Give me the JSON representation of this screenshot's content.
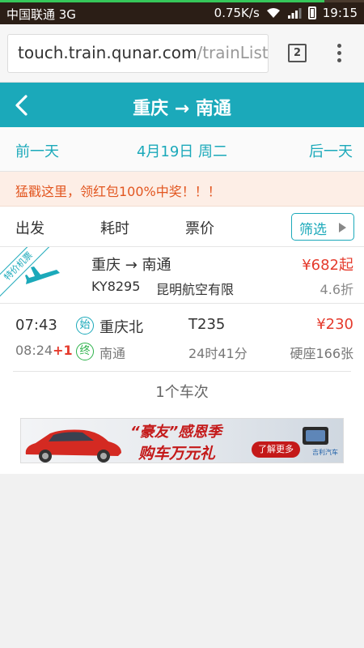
{
  "status_bar": {
    "carrier": "中国联通 3G",
    "speed": "0.75K/s",
    "time": "19:15",
    "page_load_progress": 0.89
  },
  "browser": {
    "url_host": "touch.train.qunar.com",
    "url_path": "/trainList",
    "tab_count": "2"
  },
  "header": {
    "title": "重庆 → 南通"
  },
  "date_nav": {
    "prev": "前一天",
    "current": "4月19日 周二",
    "next": "后一天"
  },
  "promo": {
    "text": "猛戳这里，领红包100%中奖！！！"
  },
  "sort_bar": {
    "depart": "出发",
    "duration": "耗时",
    "price": "票价",
    "filter": "筛选"
  },
  "flight": {
    "ribbon": "特价机票",
    "route": "重庆 → 南通",
    "price": "¥682起",
    "flight_no": "KY8295",
    "airline": "昆明航空有限",
    "discount": "4.6折"
  },
  "train": {
    "depart_time": "07:43",
    "arrive_time": "08:24",
    "day_offset": "+1",
    "start_badge": "始",
    "end_badge": "终",
    "depart_station": "重庆北",
    "arrive_station": "南通",
    "train_no": "T235",
    "duration": "24时41分",
    "price": "¥230",
    "seat": "硬座166张"
  },
  "result_count": "1个车次",
  "banner": {
    "slogan1": "“豪友”感恩季",
    "slogan2": "购车万元礼",
    "cta": "了解更多",
    "brand": "吉利汽车"
  }
}
